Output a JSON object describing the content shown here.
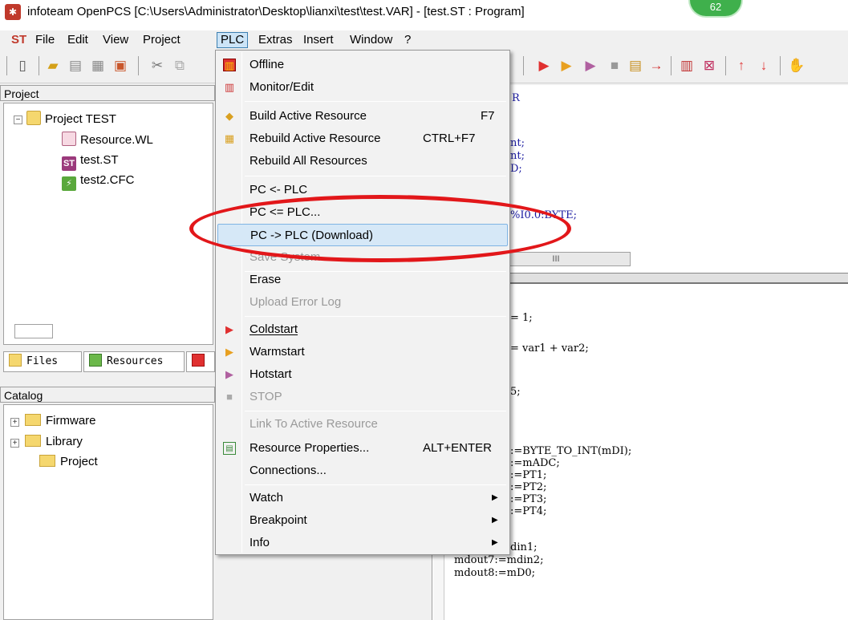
{
  "window": {
    "title": "infoteam OpenPCS [C:\\Users\\Administrator\\Desktop\\lianxi\\test\\test.VAR]  - [test.ST : Program]",
    "badge": "62"
  },
  "menubar": {
    "st_label": "ST",
    "items": [
      "File",
      "Edit",
      "View",
      "Project",
      "PLC",
      "Extras",
      "Insert",
      "Window",
      "?"
    ]
  },
  "project_panel": {
    "header": "Project",
    "root": "Project TEST",
    "items": [
      "Resource.WL",
      "test.ST",
      "test2.CFC"
    ]
  },
  "left_tabs": [
    "Files",
    "Resources"
  ],
  "catalog_panel": {
    "header": "Catalog",
    "items": [
      "Firmware",
      "Library",
      "Project"
    ]
  },
  "plc_menu": {
    "items": [
      {
        "label": "Offline",
        "shortcut": "",
        "disabled": false
      },
      {
        "label": "Monitor/Edit",
        "shortcut": "",
        "disabled": false
      },
      {
        "label": "Build Active Resource",
        "shortcut": "F7",
        "disabled": false
      },
      {
        "label": "Rebuild Active Resource",
        "shortcut": "CTRL+F7",
        "disabled": false
      },
      {
        "label": "Rebuild All Resources",
        "shortcut": "",
        "disabled": false
      },
      {
        "label": "PC <- PLC",
        "shortcut": "",
        "disabled": false
      },
      {
        "label": "PC <= PLC...",
        "shortcut": "",
        "disabled": false
      },
      {
        "label": "PC -> PLC (Download)",
        "shortcut": "",
        "disabled": false,
        "highlighted": true
      },
      {
        "label": "Save System...",
        "shortcut": "",
        "disabled": true
      },
      {
        "label": "Erase",
        "shortcut": "",
        "disabled": false
      },
      {
        "label": "Upload Error Log",
        "shortcut": "",
        "disabled": true
      },
      {
        "label": "Coldstart",
        "shortcut": "",
        "disabled": false
      },
      {
        "label": "Warmstart",
        "shortcut": "",
        "disabled": false
      },
      {
        "label": "Hotstart",
        "shortcut": "",
        "disabled": false
      },
      {
        "label": "STOP",
        "shortcut": "",
        "disabled": true
      },
      {
        "label": "Link To Active Resource",
        "shortcut": "",
        "disabled": true
      },
      {
        "label": "Resource Properties...",
        "shortcut": "ALT+ENTER",
        "disabled": false
      },
      {
        "label": "Connections...",
        "shortcut": "",
        "disabled": false
      },
      {
        "label": "Watch",
        "shortcut": "",
        "disabled": false,
        "submenu": true
      },
      {
        "label": "Breakpoint",
        "shortcut": "",
        "disabled": false,
        "submenu": true
      },
      {
        "label": "Info",
        "shortcut": "",
        "disabled": false,
        "submenu": true
      }
    ]
  },
  "editor": {
    "scroll_label": "III",
    "top_lines": [
      "R",
      "nt;",
      "nt;",
      "D;",
      "%I0.0:BYTE;"
    ],
    "bottom_lines": [
      "= 1;",
      "= var1 + var2;",
      "5;",
      ":=BYTE_TO_INT(mDI);",
      ":=mADC;",
      ":=PT1;",
      ":=PT2;",
      ":=PT3;",
      ":=PT4;",
      "din1;",
      "mdout7:=mdin2;",
      "mdout8:=mD0;"
    ]
  },
  "colors": {
    "annotation": "#e2171a",
    "highlight": "#d6e8f7",
    "menu_border": "#979797"
  }
}
